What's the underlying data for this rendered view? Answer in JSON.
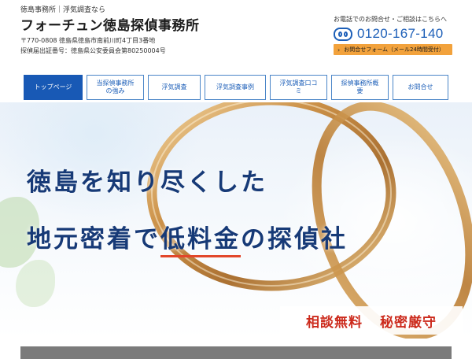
{
  "header": {
    "tagline": "徳島事務所｜浮気調査なら",
    "title": "フォーチュン徳島探偵事務所",
    "address": "〒770-0808 徳島県徳島市南前川町4丁目3番地",
    "license": "探偵届出証番号：徳島県公安委員会第80250004号",
    "contact_label": "お電話でのお問合せ・ご相談はこちらへ",
    "phone_icon": "freedial-icon",
    "phone": "0120-167-140",
    "form_button_label": "お問合せフォーム（メール24時間受付）",
    "form_button_icon": "chevron-right-icon"
  },
  "nav": {
    "items": [
      {
        "lines": [
          "トップページ"
        ],
        "active": true
      },
      {
        "lines": [
          "当探偵事務所",
          "の強み"
        ]
      },
      {
        "lines": [
          "浮気調査"
        ]
      },
      {
        "lines": [
          "浮気調査事例"
        ]
      },
      {
        "lines": [
          "浮気調査口コ",
          "ミ"
        ]
      },
      {
        "lines": [
          "探偵事務所概",
          "要"
        ]
      },
      {
        "lines": [
          "お問合せ"
        ]
      }
    ]
  },
  "hero": {
    "headline_1": "徳島を知り尽くした",
    "headline_2_a": "地元密着で",
    "headline_2_b": "低料金",
    "headline_2_c": "の探偵社",
    "badge_1": "相談無料",
    "badge_2": "秘密厳守"
  },
  "colors": {
    "brand_blue": "#1859b5",
    "headline_navy": "#173a77",
    "badge_red": "#cc2a1c",
    "form_orange": "#f2a23c"
  }
}
